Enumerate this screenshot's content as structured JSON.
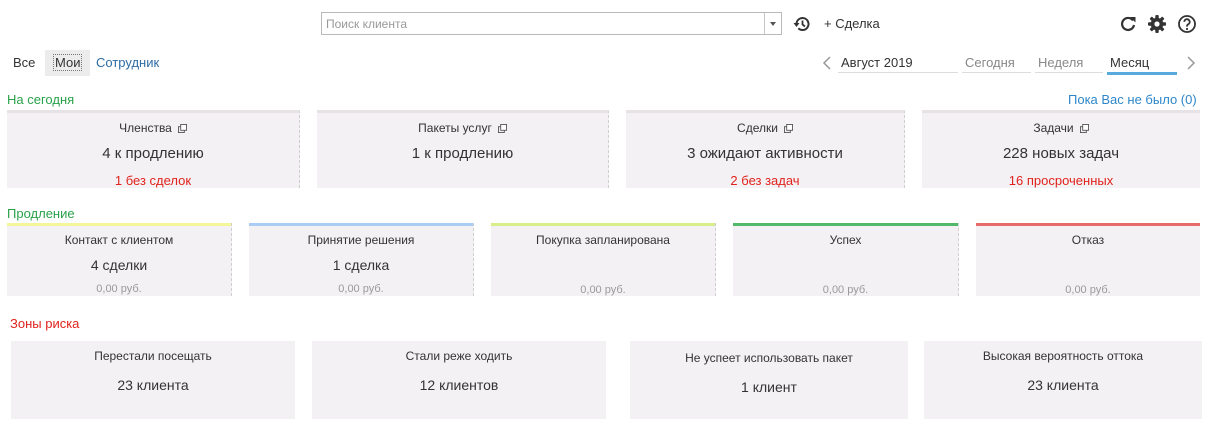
{
  "topbar": {
    "search_placeholder": "Поиск клиента",
    "new_deal_label": "+ Сделка"
  },
  "filters": {
    "all": "Все",
    "mine": "Мои",
    "employee": "Сотрудник"
  },
  "period": {
    "current": "Август 2019",
    "today": "Сегодня",
    "week": "Неделя",
    "month": "Месяц",
    "selected": "month"
  },
  "sections": {
    "today": "На сегодня",
    "renewal": "Продление",
    "risk": "Зоны риска",
    "while_away": "Пока Вас не было (0)"
  },
  "today_cards": [
    {
      "title": "Членства",
      "main": "4 к продлению",
      "warn": "1 без сделок"
    },
    {
      "title": "Пакеты услуг",
      "main": "1 к продлению",
      "warn": ""
    },
    {
      "title": "Сделки",
      "main": "3 ожидают активности",
      "warn": "2 без задач"
    },
    {
      "title": "Задачи",
      "main": "228 новых задач",
      "warn": "16 просроченных"
    }
  ],
  "renewal_cards": [
    {
      "title": "Контакт с клиентом",
      "main": "4 сделки",
      "money": "0,00 руб.",
      "color": "#f5f59a"
    },
    {
      "title": "Принятие решения",
      "main": "1 сделка",
      "money": "0,00 руб.",
      "color": "#a9cdf3"
    },
    {
      "title": "Покупка запланирована",
      "main": "",
      "money": "0,00 руб.",
      "color": "#d8ee8a"
    },
    {
      "title": "Успех",
      "main": "",
      "money": "0,00 руб.",
      "color": "#52b86a"
    },
    {
      "title": "Отказ",
      "main": "",
      "money": "0,00 руб.",
      "color": "#e86b6b"
    }
  ],
  "risk_cards": [
    {
      "title": "Перестали посещать",
      "main": "23 клиента"
    },
    {
      "title": "Стали реже ходить",
      "main": "12 клиентов"
    },
    {
      "title": "Не успеет использовать пакет",
      "main": "1 клиент"
    },
    {
      "title": "Высокая вероятность оттока",
      "main": "23 клиента"
    }
  ],
  "icons": {
    "history": "history-icon",
    "refresh": "refresh-icon",
    "settings": "gear-icon",
    "help": "help-icon",
    "external": "external-link-icon"
  }
}
